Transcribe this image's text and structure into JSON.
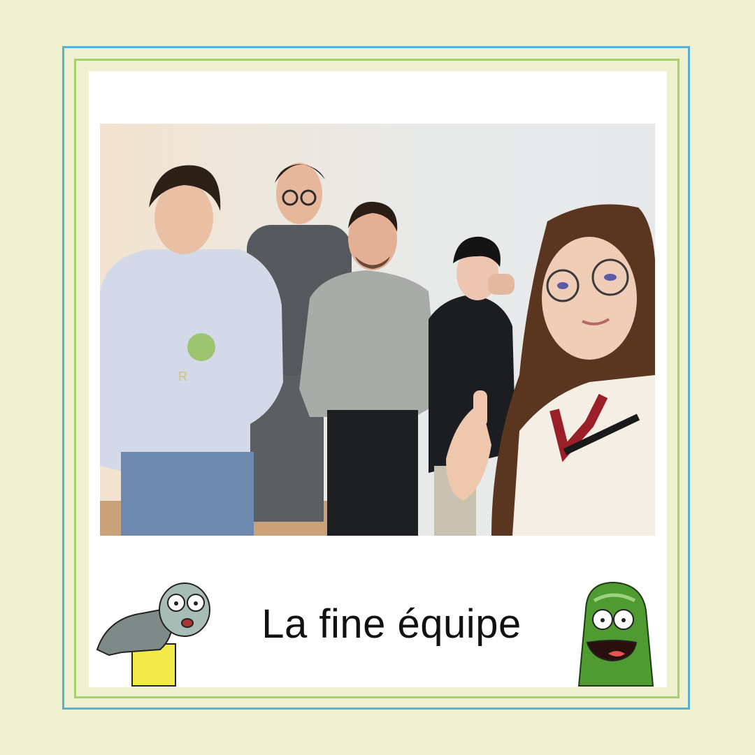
{
  "caption": "La fine équipe",
  "colors": {
    "background": "#eef0cf",
    "outer_border": "#5ab0cf",
    "inner_border": "#a9d16b",
    "card": "#ffffff"
  },
  "photo": {
    "people_count": 5,
    "scene": "group-selfie"
  },
  "characters": {
    "left": "fish-head-character",
    "right": "pickle-character"
  }
}
